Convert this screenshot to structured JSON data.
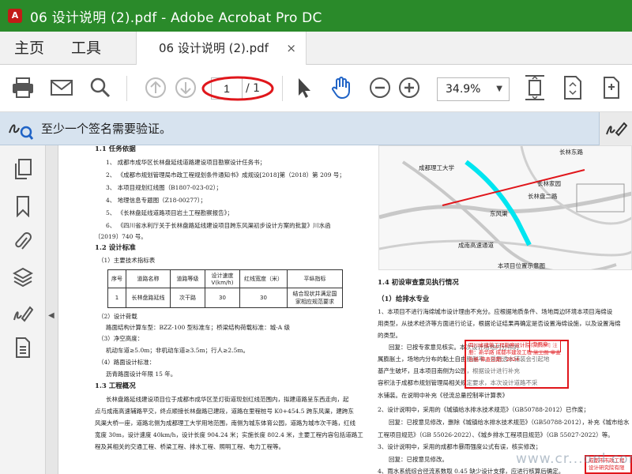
{
  "window": {
    "app_icon_glyph": "A",
    "title": "06 设计说明 (2).pdf - Adobe Acrobat Pro DC"
  },
  "menu": {
    "home": "主页",
    "tools": "工具"
  },
  "tab": {
    "doc_title": "06 设计说明 (2).pdf",
    "close_glyph": "×"
  },
  "toolbar": {
    "current_page": "1",
    "total_pages": "/ 1",
    "zoom": "34.9%",
    "zoom_caret": "▼"
  },
  "notice": {
    "text": "至少一个签名需要验证。"
  },
  "sidebar": {
    "collapse_glyph": "◀"
  },
  "document": {
    "left_lines": [
      "1.1 任务依据",
      "1、  成都市成华区长林盘延线道路建设项目勘察设计任务书；",
      "2、 《成都市规划管理局市政工程规划条件通知书》成规设[2018]第（2018）第 209 号；",
      "3、  本项目规划红线图（B1807-023-02）；",
      "4、  地理信息专题图（Z18-00277）；",
      "5、 《长林盘延线道路项目岩土工程勘察报告》；",
      "6、 《四川省水利厅关于长林盘路延线建设项目跨东风渠初步设计方案的批复》川水函",
      "〔2019〕740 号。",
      "1.2 设计标准",
      "（1）主要技术指标表",
      "（2）设计荷载",
      "路面结构计算车型：BZZ-100 型标准车；桥梁结构荷载标准：城-A 级",
      "（3）净空高度：",
      "机动车道≥5.0m；非机动车道≥3.5m；行人≥2.5m。",
      "（4）路面设计标准：",
      "沥青路面设计年限 15 年。",
      "1.3 工程概况",
      "长林盘路延线建设项目位于成都市成华区圣灯街道现划红线范围内，拟建道路呈东西走向，起",
      "点与成南高速辅路平交，终点顺接长林盘路已建段，道路在里程桩号 K0+454.5 跨东风渠，建跨东",
      "风渠大桥一座，道路北侧为成都理工大学用地范围，南侧为城东体育公园，道路为城市次干路，红线",
      "宽度 30m，设计速度 40km/h，设计长度 904.24 米；实施长度 802.4 米，主要工程内容包括道路工",
      "程及其相关的交通工程、桥梁工程、排水工程、照明工程、电力工程等。"
    ],
    "table": {
      "headers": [
        "序号",
        "道路名称",
        "道路等级",
        "设计速度 V(km/h)",
        "红线宽度（米）",
        "平纵指标"
      ],
      "row": [
        "1",
        "长林盘路延线",
        "次干路",
        "30",
        "30",
        "结合现状并满足国家相应规范要求"
      ]
    },
    "map_labels": [
      "成都理工大学",
      "长林东路",
      "长林家园",
      "长林盘二路",
      "成南高速通道",
      "东风渠",
      "本项目位置示意图"
    ],
    "right_lines": [
      "1.4 初设审查意见执行情况",
      "（1）给排水专业",
      "1、本项目不进行海绵城市设计理由不充分。应根据地质条件、场地周边环境本项目海绵设",
      "用类型，从技术经济等方面进行论证，根据论证结果再确定是否设置海绵设施，以及设置海绵",
      "的类型。",
      "回复：已按专家意见核实。本次设计场地内分布的",
      "属膨胀土，场地内分布的黏土自由膨胀率，采用透水铺装会引起地",
      "基产生破坏，且本项目南侧为公园，根据设计进行补充",
      "容积法于成都市规划管理局相关规定要求，本次设计道路不采",
      "水铺装。在说明中补充《径流总量控制率计算表》",
      "2、设计说明中，采用的《城镇给水排水技术规范》（GB50788-2012）已作废；",
      "回复：已按意见修改，删除《城镇给水排水技术规范》（GB50788-2012），补充《城市给水",
      "工程项目规范》（GB 55026-2022）、《城乡排水工程项目规范》（GB 55027-2022）等。",
      "3、设计说明中，采用的成都市暴雨强度公式有误，核实修改；",
      "回复：已按意见修改。",
      "4、雨水系统综合径流系数取 0.45 缺少设计支撑，应进行核算后确定。"
    ],
    "stamps": [
      "四川省建筑工程勘察设计院有限公司 注册：新华路 成都市建设工程 施工图 审查合格 审查日期：2024",
      "专用章",
      "成都市市政工程设计研究院有限公司"
    ]
  },
  "watermark": "www.cr...onl.com",
  "colors": {
    "titlebar": "#2a8a2a",
    "notice_bg": "#d7e3ef",
    "highlight_ring": "#e0161b",
    "map_channel": "#00e5f0",
    "accent_blue": "#1f63c6"
  }
}
